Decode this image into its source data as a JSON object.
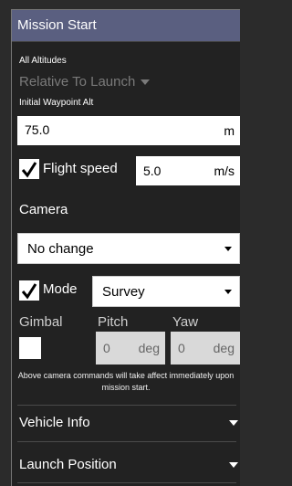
{
  "header": {
    "title": "Mission Start"
  },
  "altitude": {
    "mode_label": "All Altitudes",
    "mode_value": "Relative To Launch",
    "initial_label": "Initial Waypoint Alt",
    "initial_value": "75.0",
    "initial_unit": "m"
  },
  "flight_speed": {
    "label": "Flight speed",
    "checked": true,
    "value": "5.0",
    "unit": "m/s"
  },
  "camera": {
    "label": "Camera",
    "action_value": "No change",
    "mode_label": "Mode",
    "mode_checked": true,
    "mode_value": "Survey"
  },
  "gimbal": {
    "label": "Gimbal",
    "pitch_label": "Pitch",
    "yaw_label": "Yaw",
    "pitch_value": "0",
    "pitch_unit": "deg",
    "yaw_value": "0",
    "yaw_unit": "deg",
    "note": "Above camera commands will take affect immediately upon mission start."
  },
  "sections": {
    "vehicle_info": "Vehicle Info",
    "launch_position": "Launch Position"
  }
}
